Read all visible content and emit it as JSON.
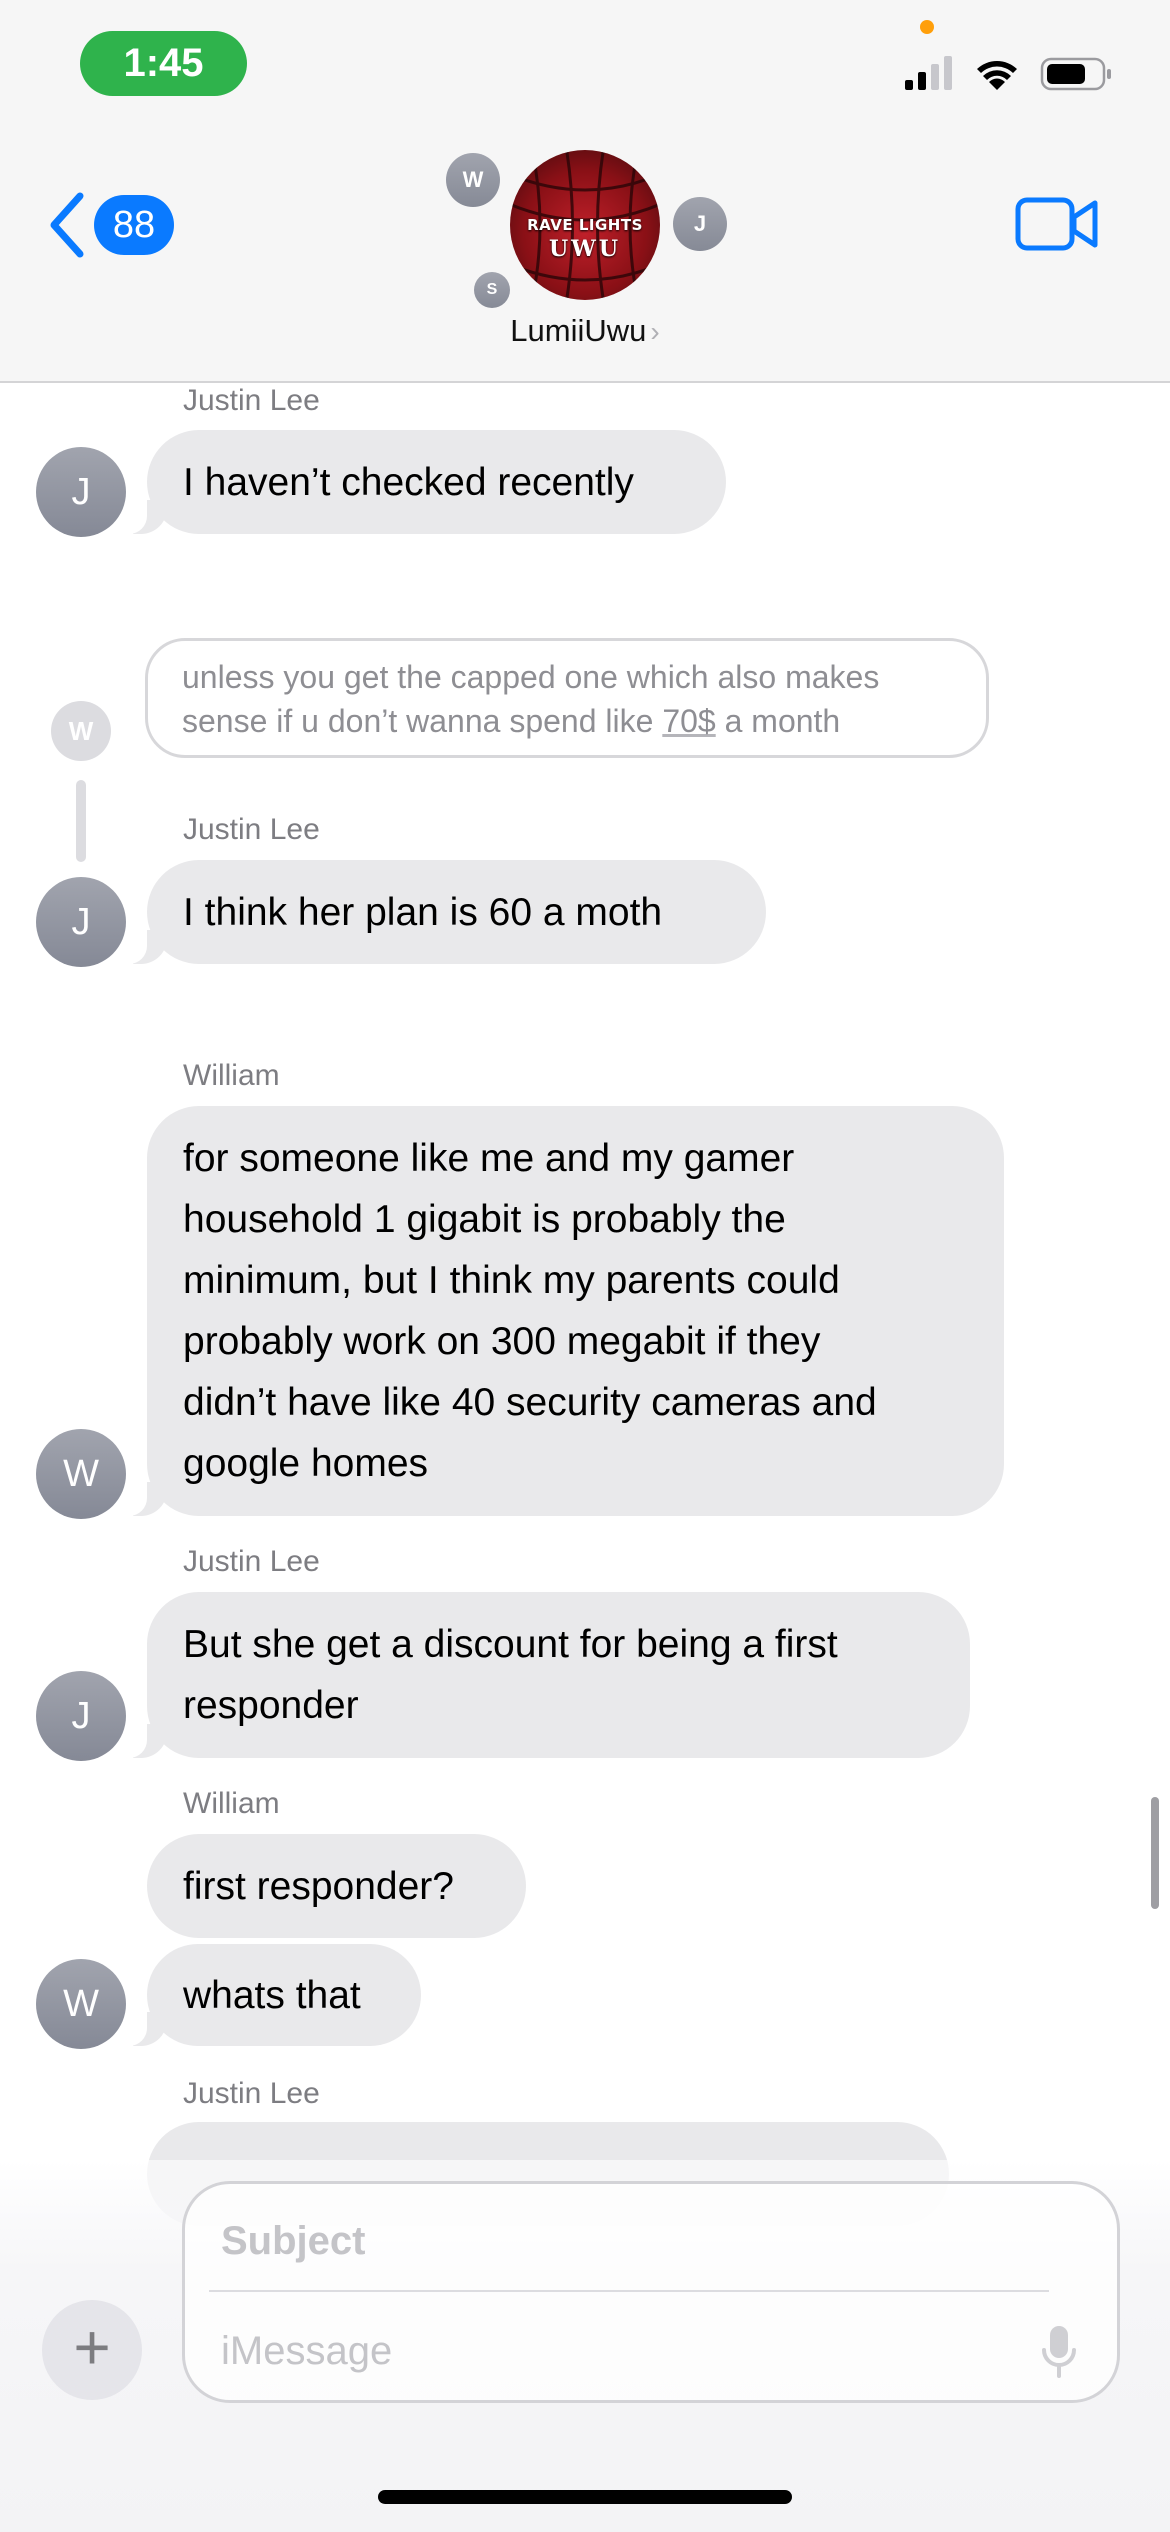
{
  "status_bar": {
    "time": "1:45",
    "icons": [
      "cellular-signal-icon",
      "wifi-icon",
      "battery-icon"
    ],
    "privacy_indicator_color": "#ff9f0a"
  },
  "header": {
    "back_badge_count": "88",
    "group_name": "LumiiUwu",
    "group_photo_text_line1": "RAVE LIGHTS",
    "group_photo_text_line2": "UWU",
    "participant_initials": [
      "W",
      "J",
      "S"
    ],
    "video_icon": "video-camera-icon"
  },
  "messages": [
    {
      "sender": "Justin Lee",
      "avatar": "J",
      "text": "I haven’t checked recently"
    },
    {
      "reply_avatar": "W",
      "reply_text_1": "unless you get the capped one which also makes",
      "reply_text_2a": "sense if u don’t wanna spend like ",
      "reply_text_2b": "70$",
      "reply_text_2c": " a month"
    },
    {
      "sender": "Justin Lee",
      "avatar": "J",
      "text": "I think her plan is 60 a moth"
    },
    {
      "sender": "William",
      "avatar": "W",
      "lines": [
        "for someone like me and my gamer",
        "household 1 gigabit is probably the",
        "minimum, but I think my parents could",
        "probably work on 300 megabit if they",
        "didn’t have like 40 security cameras and",
        "google homes"
      ]
    },
    {
      "sender": "Justin Lee",
      "avatar": "J",
      "lines": [
        "But she get a discount for being a first",
        "responder"
      ]
    },
    {
      "sender": "William",
      "avatar": "W",
      "text_1": "first responder?",
      "text_2": "whats that"
    },
    {
      "sender": "Justin Lee"
    }
  ],
  "compose": {
    "subject_placeholder": "Subject",
    "message_placeholder": "iMessage",
    "plus_label": "+"
  },
  "colors": {
    "accent": "#0a7aff",
    "bubble_received": "#e9e9eb",
    "time_pill": "#2fb34c"
  }
}
